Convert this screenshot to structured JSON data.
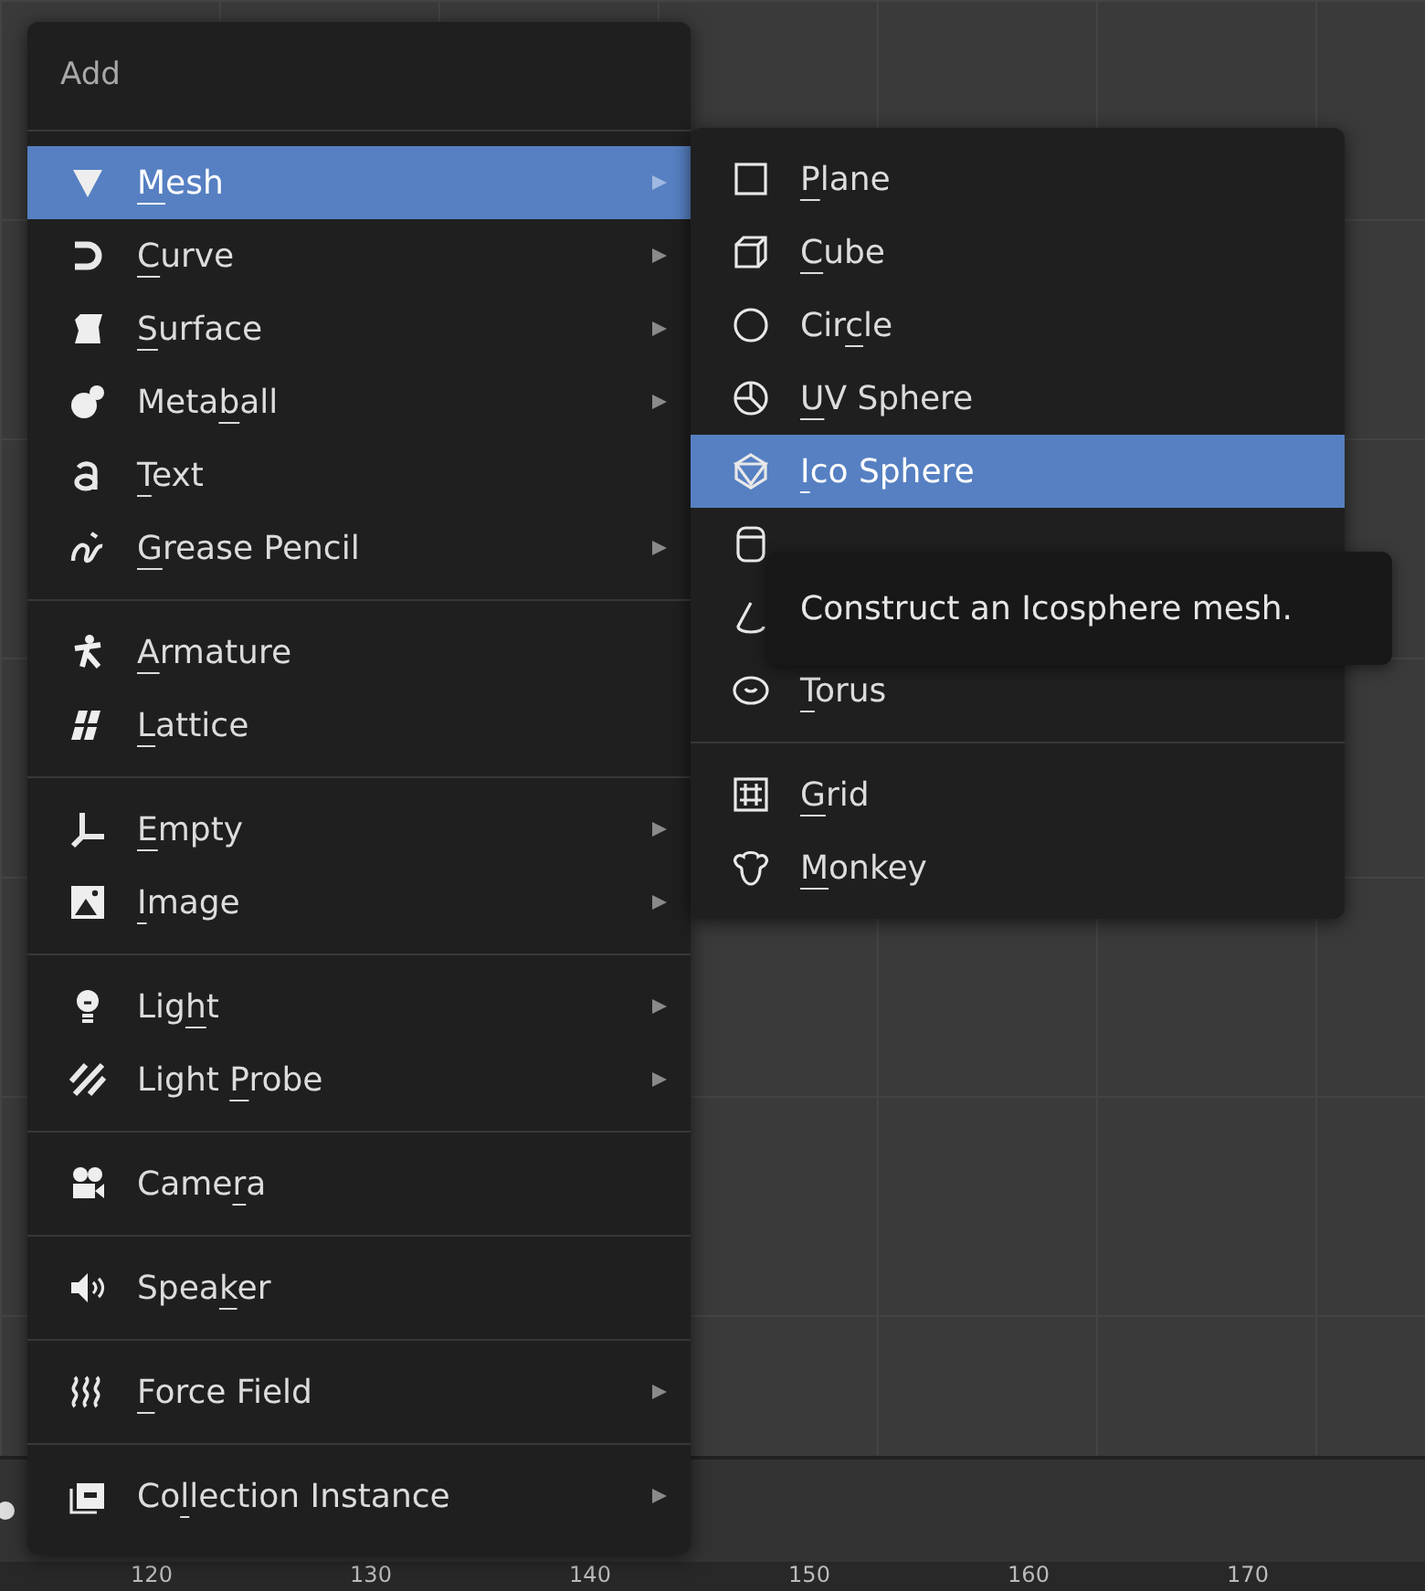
{
  "add_menu": {
    "title": "Add",
    "groups": [
      [
        {
          "kind": "mesh",
          "label": {
            "key": "M",
            "after": "esh"
          },
          "submenu": true,
          "selected": true
        },
        {
          "kind": "curve",
          "label": {
            "key": "C",
            "after": "urve"
          },
          "submenu": true,
          "selected": false
        },
        {
          "kind": "surface",
          "label": {
            "key": "S",
            "after": "urface"
          },
          "submenu": true,
          "selected": false
        },
        {
          "kind": "metaball",
          "label": {
            "before": "Meta",
            "key": "b",
            "after": "all"
          },
          "submenu": true,
          "selected": false
        },
        {
          "kind": "text",
          "label": {
            "key": "T",
            "after": "ext"
          },
          "submenu": false,
          "selected": false
        },
        {
          "kind": "grease",
          "label": {
            "key": "G",
            "after": "rease Pencil"
          },
          "submenu": true,
          "selected": false
        }
      ],
      [
        {
          "kind": "armature",
          "label": {
            "key": "A",
            "after": "rmature"
          },
          "submenu": false,
          "selected": false
        },
        {
          "kind": "lattice",
          "label": {
            "key": "L",
            "after": "attice"
          },
          "submenu": false,
          "selected": false
        }
      ],
      [
        {
          "kind": "empty",
          "label": {
            "key": "E",
            "after": "mpty"
          },
          "submenu": true,
          "selected": false
        },
        {
          "kind": "image",
          "label": {
            "key": "I",
            "after": "mage"
          },
          "submenu": true,
          "selected": false
        }
      ],
      [
        {
          "kind": "light",
          "label": {
            "before": "Lig",
            "key": "h",
            "after": "t"
          },
          "submenu": true,
          "selected": false
        },
        {
          "kind": "probe",
          "label": {
            "before": "Light ",
            "key": "P",
            "after": "robe"
          },
          "submenu": true,
          "selected": false
        }
      ],
      [
        {
          "kind": "camera",
          "label": {
            "before": "Came",
            "key": "r",
            "after": "a"
          },
          "submenu": false,
          "selected": false
        }
      ],
      [
        {
          "kind": "speaker",
          "label": {
            "before": "Spea",
            "key": "k",
            "after": "er"
          },
          "submenu": false,
          "selected": false
        }
      ],
      [
        {
          "kind": "force",
          "label": {
            "key": "F",
            "after": "orce Field"
          },
          "submenu": true,
          "selected": false
        }
      ],
      [
        {
          "kind": "collection",
          "label": {
            "before": "Co",
            "key": "l",
            "after": "lection Instance"
          },
          "submenu": true,
          "selected": false
        }
      ]
    ]
  },
  "mesh_menu": {
    "groups": [
      [
        {
          "kind": "plane",
          "label": {
            "key": "P",
            "after": "lane"
          },
          "selected": false
        },
        {
          "kind": "cube",
          "label": {
            "key": "C",
            "after": "ube"
          },
          "selected": false
        },
        {
          "kind": "circle",
          "label": {
            "before": "Cir",
            "key": "c",
            "after": "le"
          },
          "selected": false
        },
        {
          "kind": "uvsphere",
          "label": {
            "key": "U",
            "after": "V Sphere"
          },
          "selected": false
        },
        {
          "kind": "icosphere",
          "label": {
            "key": "I",
            "after": "co Sphere"
          },
          "selected": true
        },
        {
          "kind": "cylinder",
          "selected": false
        },
        {
          "kind": "cone",
          "selected": false
        },
        {
          "kind": "torus",
          "label": {
            "key": "T",
            "after": "orus"
          },
          "selected": false
        }
      ],
      [
        {
          "kind": "grid",
          "label": {
            "key": "G",
            "after": "rid"
          },
          "selected": false
        },
        {
          "kind": "monkey",
          "label": {
            "key": "M",
            "after": "onkey"
          },
          "selected": false
        }
      ]
    ]
  },
  "tooltip": "Construct an Icosphere mesh.",
  "timeline_ruler": [
    "120",
    "130",
    "140",
    "150",
    "160",
    "170"
  ]
}
